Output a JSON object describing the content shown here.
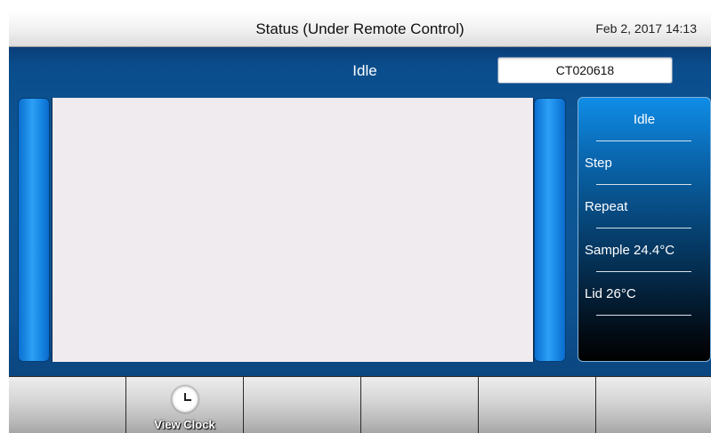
{
  "header": {
    "title": "Status (Under Remote Control)",
    "datetime": "Feb 2, 2017 14:13"
  },
  "main": {
    "state": "Idle",
    "serial": "CT020618"
  },
  "status_panel": {
    "items": [
      {
        "label": "Idle"
      },
      {
        "label": "Step"
      },
      {
        "label": "Repeat"
      },
      {
        "label": "Sample 24.4°C"
      },
      {
        "label": "Lid 26°C"
      }
    ]
  },
  "softkeys": [
    {
      "label": ""
    },
    {
      "label": "View Clock",
      "icon": "clock-icon"
    },
    {
      "label": ""
    },
    {
      "label": ""
    },
    {
      "label": ""
    },
    {
      "label": ""
    }
  ],
  "colors": {
    "main_bg": "#0d5796",
    "bar_blue": "#2ca0f5",
    "panel_bg": "#efebee"
  }
}
